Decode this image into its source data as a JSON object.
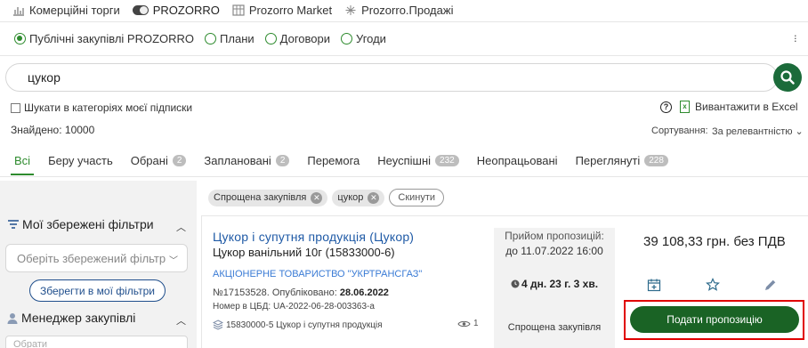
{
  "topnav": [
    {
      "label": "Комерційні торги",
      "icon": "chart-icon"
    },
    {
      "label": "PROZORRO",
      "icon": "toggle-icon"
    },
    {
      "label": "Prozorro Market",
      "icon": "grid-icon"
    },
    {
      "label": "Prozorro.Продажі",
      "icon": "sparkle-icon"
    }
  ],
  "radios": [
    "Публічні закупівлі PROZORRO",
    "Плани",
    "Договори",
    "Угоди"
  ],
  "search": {
    "value": "цукор"
  },
  "subscription_checkbox": "Шукати в категоріях моєї підписки",
  "found": "Знайдено: 10000",
  "export_excel": "Вивантажити в Excel",
  "sort": {
    "label": "Сортування:",
    "value": "За релевантністю"
  },
  "tabs": [
    {
      "label": "Всі",
      "badge": ""
    },
    {
      "label": "Беру участь",
      "badge": ""
    },
    {
      "label": "Обрані",
      "badge": "2"
    },
    {
      "label": "Заплановані",
      "badge": "2"
    },
    {
      "label": "Перемога",
      "badge": ""
    },
    {
      "label": "Неуспішні",
      "badge": "232"
    },
    {
      "label": "Неопрацьовані",
      "badge": ""
    },
    {
      "label": "Переглянуті",
      "badge": "228"
    }
  ],
  "left_panel": {
    "saved_filters_title": "Мої збережені фільтри",
    "saved_filter_placeholder": "Оберіть збережений фільтр",
    "save_button": "Зберегти в мої фільтри",
    "manager_title": "Менеджер закупівлі",
    "manager_placeholder": "Обрати"
  },
  "chips": [
    "Спрощена закупівля",
    "цукор"
  ],
  "reset_label": "Скинути",
  "card": {
    "title": "Цукор і супутня продукція (Цукор)",
    "subtitle": "Цукор ванільний 10г (15833000-6)",
    "organization": "АКЦІОНЕРНЕ ТОВАРИСТВО \"УКРТРАНСГАЗ\"",
    "id_prefix": "№17153528. Опубліковано:",
    "published": "28.06.2022",
    "cbd": "Номер в ЦБД: UA-2022-06-28-003363-a",
    "classification": "15830000-5 Цукор і супутня продукція",
    "views": "1",
    "status": "Прийом пропозицій:",
    "deadline": "до 11.07.2022 16:00",
    "timer": "4 дн. 23 г. 3 хв.",
    "procurement_type": "Спрощена закупівля",
    "price": "39 108,33 грн. без ПДВ",
    "submit_label": "Подати пропозицію"
  },
  "colors": {
    "accent": "#2e8b2e",
    "submit": "#1a6325",
    "link": "#1f5aa6",
    "highlight": "#e00000"
  }
}
